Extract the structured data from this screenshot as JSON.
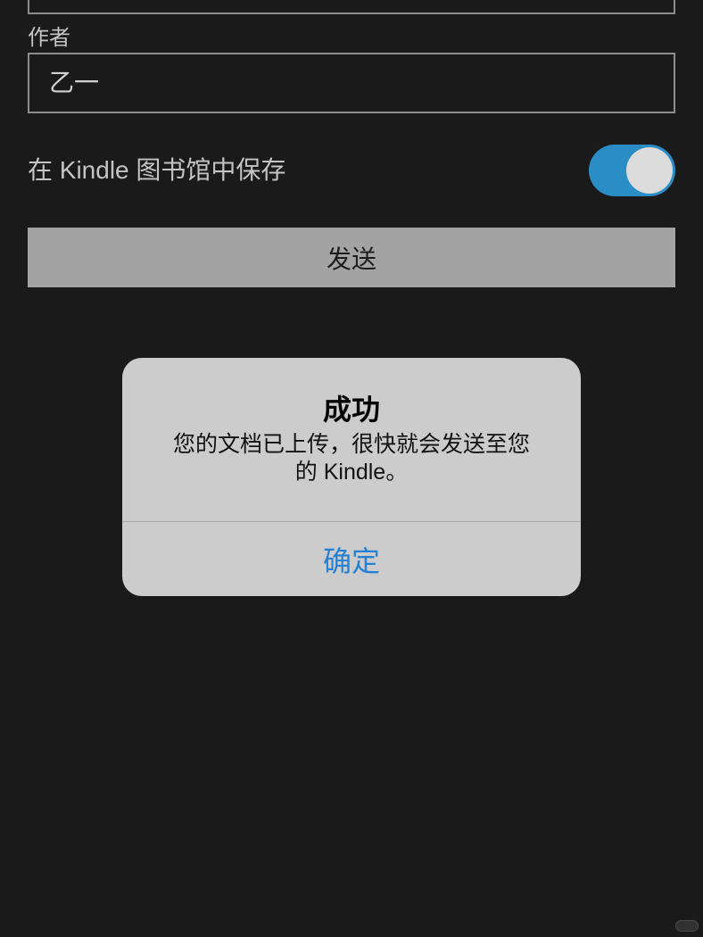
{
  "form": {
    "author_label": "作者",
    "author_value": "乙一",
    "save_label": "在 Kindle 图书馆中保存",
    "save_toggle_on": true,
    "send_label": "发送"
  },
  "alert": {
    "title": "成功",
    "message": "您的文档已上传，很快就会发送至您的 Kindle。",
    "confirm_label": "确定"
  },
  "colors": {
    "background": "#1a1a1a",
    "toggle_on": "#2a8dc5",
    "alert_background": "#cccccc",
    "alert_button": "#2680d4"
  }
}
